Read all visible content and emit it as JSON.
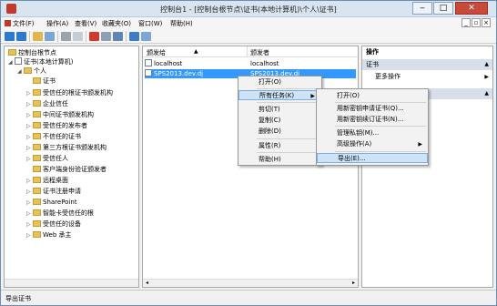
{
  "window": {
    "title": "控制台1 - [控制台根节点\\证书(本地计算机)\\个人\\证书]",
    "min_label": "‒",
    "max_label": "□",
    "close_label": "✕"
  },
  "menubar": {
    "items": [
      "文件(F)",
      "操作(A)",
      "查看(V)",
      "收藏夹(O)",
      "窗口(W)",
      "帮助(H)"
    ],
    "mdi": [
      "_",
      "▫",
      "×"
    ]
  },
  "tree": {
    "items": [
      {
        "label": "控制台根节点",
        "arrow": ""
      },
      {
        "label": "证书(本地计算机)",
        "arrow": "◢"
      },
      {
        "label": "个人",
        "arrow": "◢"
      },
      {
        "label": "证书",
        "arrow": ""
      },
      {
        "label": "受信任的根证书颁发机构",
        "arrow": "▷"
      },
      {
        "label": "企业信任",
        "arrow": "▷"
      },
      {
        "label": "中间证书颁发机构",
        "arrow": "▷"
      },
      {
        "label": "受信任的发布者",
        "arrow": "▷"
      },
      {
        "label": "不信任的证书",
        "arrow": "▷"
      },
      {
        "label": "第三方根证书颁发机构",
        "arrow": "▷"
      },
      {
        "label": "受信任人",
        "arrow": "▷"
      },
      {
        "label": "客户端身份验证颁发者",
        "arrow": ""
      },
      {
        "label": "远程桌面",
        "arrow": "▷"
      },
      {
        "label": "证书注册申请",
        "arrow": "▷"
      },
      {
        "label": "SharePoint",
        "arrow": "▷"
      },
      {
        "label": "智能卡受信任的根",
        "arrow": "▷"
      },
      {
        "label": "受信任的设备",
        "arrow": "▷"
      },
      {
        "label": "Web 承主",
        "arrow": "▷"
      }
    ]
  },
  "list": {
    "col_issued_to": "颁发给",
    "col_issued_by": "颁发者",
    "rows": [
      {
        "to": "localhost",
        "by": "localhost"
      },
      {
        "to": "SPS2013.dev.dj",
        "by": "SPS2013.dev.dj"
      }
    ]
  },
  "context_menu": {
    "open": "打开(O)",
    "all_tasks": "所有任务(K)",
    "cut": "剪切(T)",
    "copy": "复制(C)",
    "delete": "删除(D)",
    "properties": "属性(R)",
    "help": "帮助(H)"
  },
  "submenu": {
    "open": "打开(O)",
    "request_new_key": "用新密钥申请证书(Q)...",
    "renew_new_key": "用新密钥续订证书(N)...",
    "manage_keys": "管理私钥(M)...",
    "advanced": "高级操作(A)",
    "export": "导出(E)..."
  },
  "actions": {
    "header": "操作",
    "group": "证书",
    "more": "更多操作"
  },
  "statusbar": {
    "text": "导出证书"
  }
}
